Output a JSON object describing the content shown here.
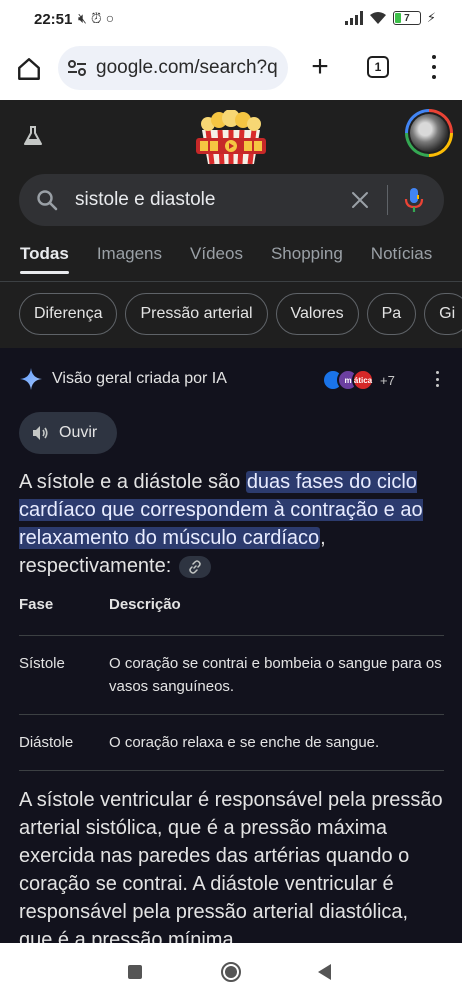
{
  "status_bar": {
    "time": "22:51",
    "battery_level": "7",
    "battery_fraction": 0.07
  },
  "browser": {
    "url": "google.com/search?q",
    "tab_count": "1"
  },
  "search": {
    "query": "sistole e diastole"
  },
  "tabs": [
    "Todas",
    "Imagens",
    "Vídeos",
    "Shopping",
    "Notícias"
  ],
  "chips": [
    "Diferença",
    "Pressão arterial",
    "Valores",
    "Pa",
    "Gi"
  ],
  "ai_overview": {
    "title": "Visão geral criada por IA",
    "sources_more": "+7",
    "source_labels": [
      "",
      "m",
      "ática"
    ],
    "listen_label": "Ouvir",
    "intro_before": "A sístole e a diástole são ",
    "intro_highlight": "duas fases do ciclo cardíaco que correspondem à contração e ao relaxamento do músculo cardíaco",
    "intro_after": ", respectivamente:",
    "table": {
      "headers": [
        "Fase",
        "Descrição"
      ],
      "rows": [
        [
          "Sístole",
          "O coração se contrai e bombeia o sangue para os vasos sanguíneos."
        ],
        [
          "Diástole",
          "O coração relaxa e se enche de sangue."
        ]
      ]
    },
    "paragraph": "A sístole ventricular é responsável pela pressão arterial sistólica, que é a pressão máxima exercida nas paredes das artérias quando o coração se contrai. A diástole ventricular é responsável pela pressão arterial diastólica, que é a pressão mínima"
  },
  "icons": {
    "flask": "flask-icon",
    "search": "search-icon",
    "clear": "close-icon",
    "mic": "mic-icon",
    "sparkle": "ai-sparkle-icon",
    "speaker": "speaker-icon",
    "link": "link-icon"
  }
}
